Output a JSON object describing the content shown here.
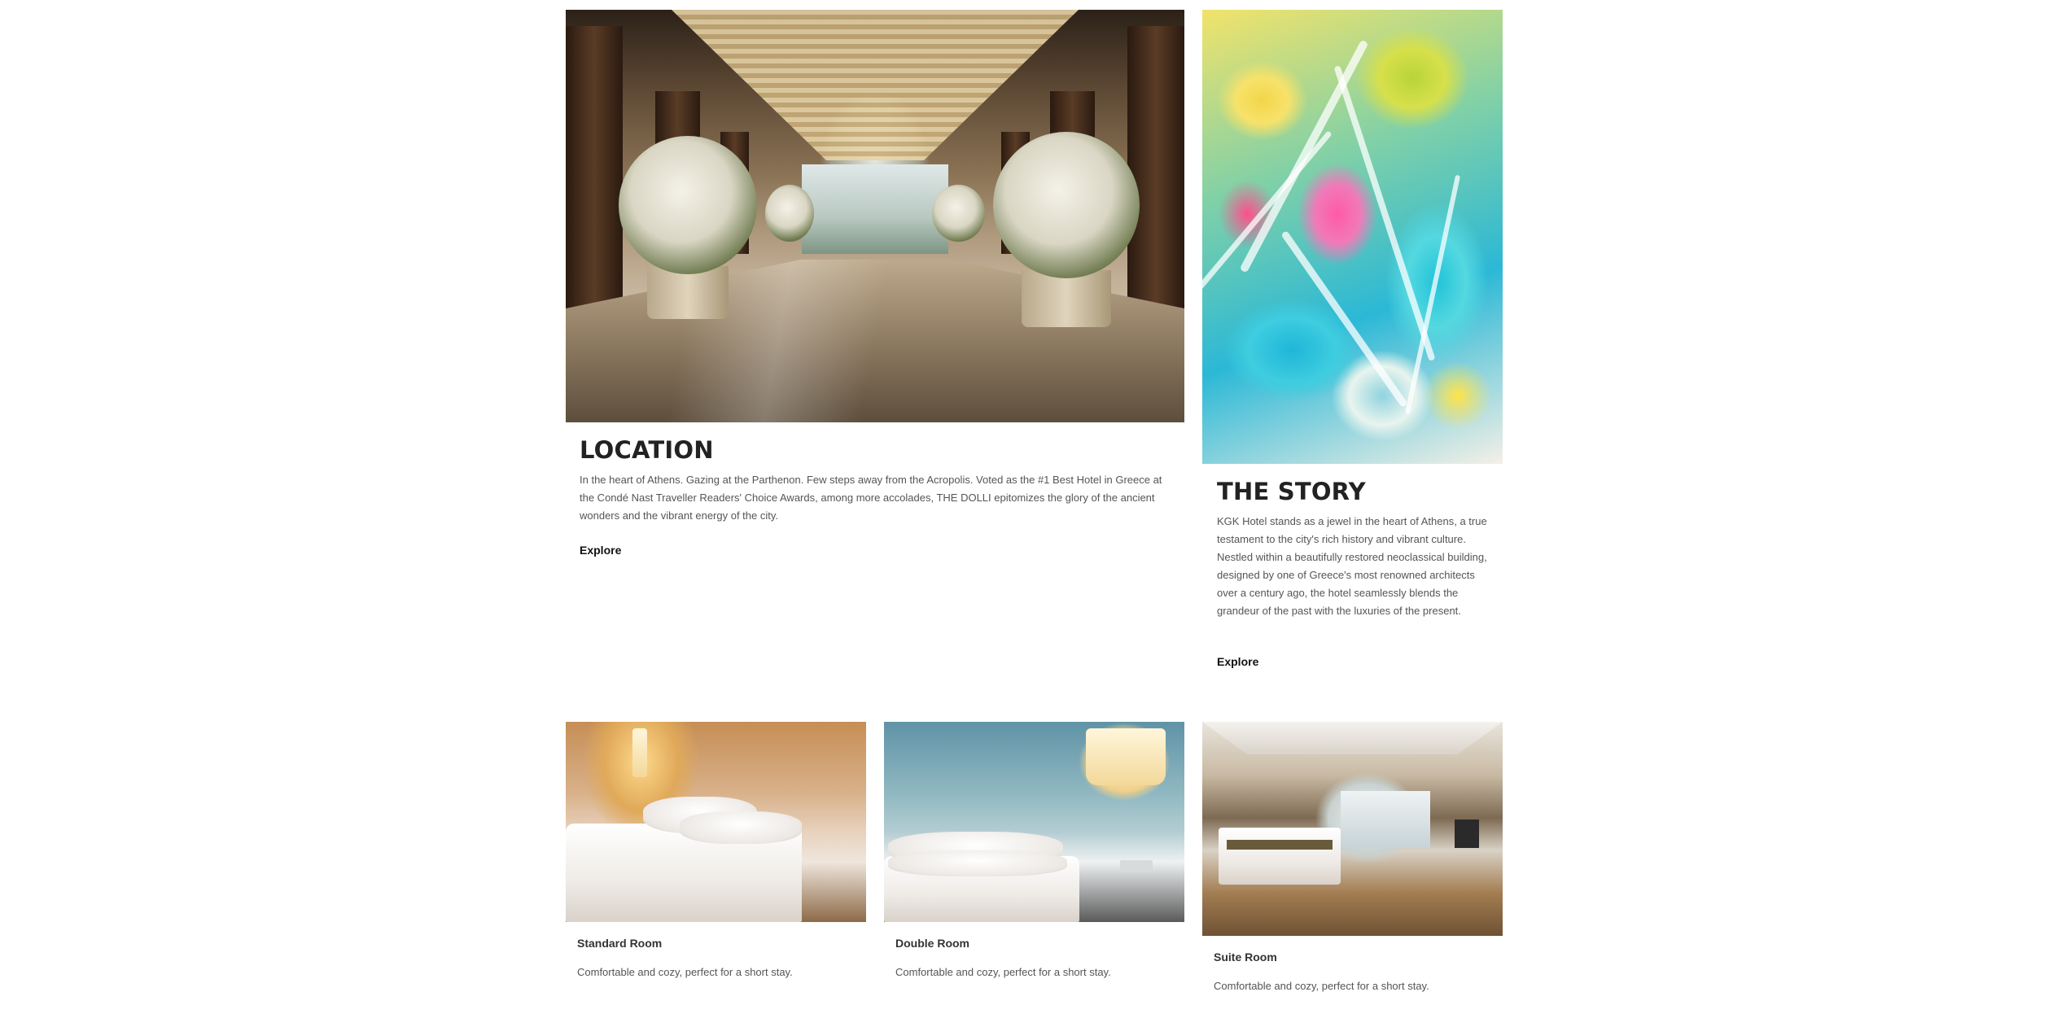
{
  "location": {
    "heading": "LOCATION",
    "body": "In the heart of Athens. Gazing at the Parthenon. Few steps away from the Acropolis. Voted as the #1 Best Hotel in Greece at the Condé Nast Traveller Readers' Choice Awards, among more accolades, THE DOLLI epitomizes the glory of the ancient wonders and the vibrant energy of the city.",
    "link_label": "Explore"
  },
  "story": {
    "heading": "THE STORY",
    "body": "KGK Hotel stands as a jewel in the heart of Athens, a true testament to the city's rich history and vibrant culture. Nestled within a beautifully restored neoclassical building, designed by one of Greece's most renowned architects over a century ago, the hotel seamlessly blends the grandeur of the past with the luxuries of the present.",
    "link_label": "Explore"
  },
  "rooms": [
    {
      "title": "Standard Room",
      "description": "Comfortable and cozy, perfect for a short stay."
    },
    {
      "title": "Double Room",
      "description": "Comfortable and cozy, perfect for a short stay."
    },
    {
      "title": "Suite Room",
      "description": "Comfortable and cozy, perfect for a short stay."
    }
  ],
  "colors": {
    "background": "#ffffff",
    "heading": "#222222",
    "body_text": "#555555",
    "link": "#111111"
  },
  "icons": {
    "lobby_photo": "hotel-lobby-photo",
    "art_photo": "abstract-painting-photo",
    "room_photos": [
      "standard-room-photo",
      "double-room-photo",
      "suite-room-photo"
    ]
  }
}
